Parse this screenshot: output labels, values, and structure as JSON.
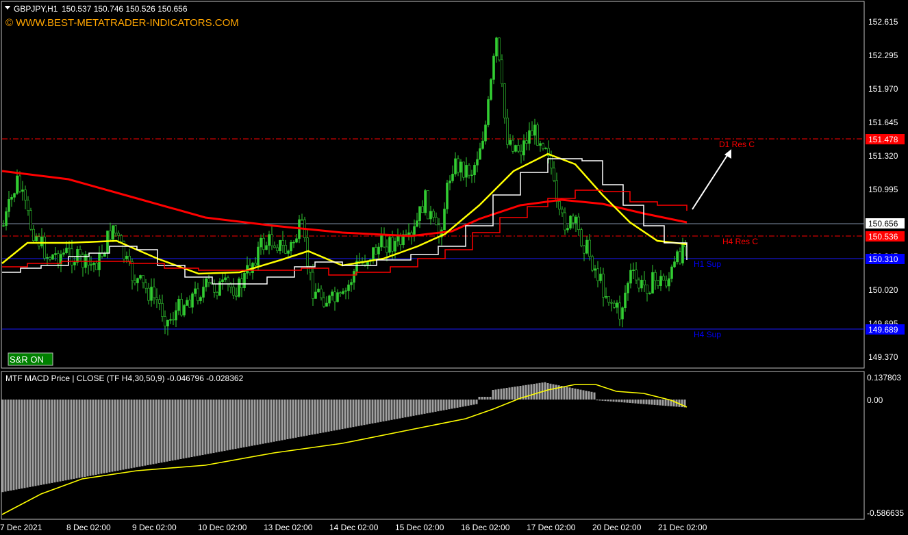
{
  "main_chart": {
    "header": {
      "symbol": "GBPJPY,H1",
      "ohlc": "150.537 150.746 150.526 150.656",
      "watermark": "© WWW.BEST-METATRADER-INDICATORS.COM"
    },
    "y_axis_ticks": [
      "152.615",
      "152.295",
      "151.970",
      "151.645",
      "151.320",
      "150.995",
      "150.345",
      "150.020",
      "149.695",
      "149.370"
    ],
    "price_tags": [
      {
        "label": "151.478",
        "color": "#ff0000"
      },
      {
        "label": "150.656",
        "color": "#000000"
      },
      {
        "label": "150.536",
        "color": "#ff0000"
      },
      {
        "label": "150.310",
        "color": "#0000ff"
      },
      {
        "label": "149.689",
        "color": "#0000ff"
      }
    ],
    "level_labels": [
      {
        "label": "D1 Res C",
        "color": "#ff0000"
      },
      {
        "label": "H4 Res C",
        "color": "#ff0000"
      },
      {
        "label": "H1 Sup",
        "color": "#0000ff"
      },
      {
        "label": "H4 Sup",
        "color": "#0000ff"
      }
    ],
    "sr_button": "S&R  ON"
  },
  "macd_panel": {
    "title": "MTF MACD Price | CLOSE  (TF H4,30,50,9) -0.046796 -0.028362",
    "y_axis_ticks": [
      "0.137803",
      "0.00",
      "-0.586635"
    ]
  },
  "x_axis_labels": [
    "7 Dec 2021",
    "8 Dec 02:00",
    "9 Dec 02:00",
    "10 Dec 02:00",
    "13 Dec 02:00",
    "14 Dec 02:00",
    "15 Dec 02:00",
    "16 Dec 02:00",
    "17 Dec 02:00",
    "20 Dec 02:00",
    "21 Dec 02:00"
  ],
  "colors": {
    "candles": "#32cd32",
    "ma_red": "#ff0000",
    "ma_yellow": "#ffff00",
    "step_white": "#ffffff",
    "step_red": "#ff0000",
    "histogram": "#a0a0a0",
    "signal": "#ffff00",
    "grid_border": "#c0c0c0"
  }
}
